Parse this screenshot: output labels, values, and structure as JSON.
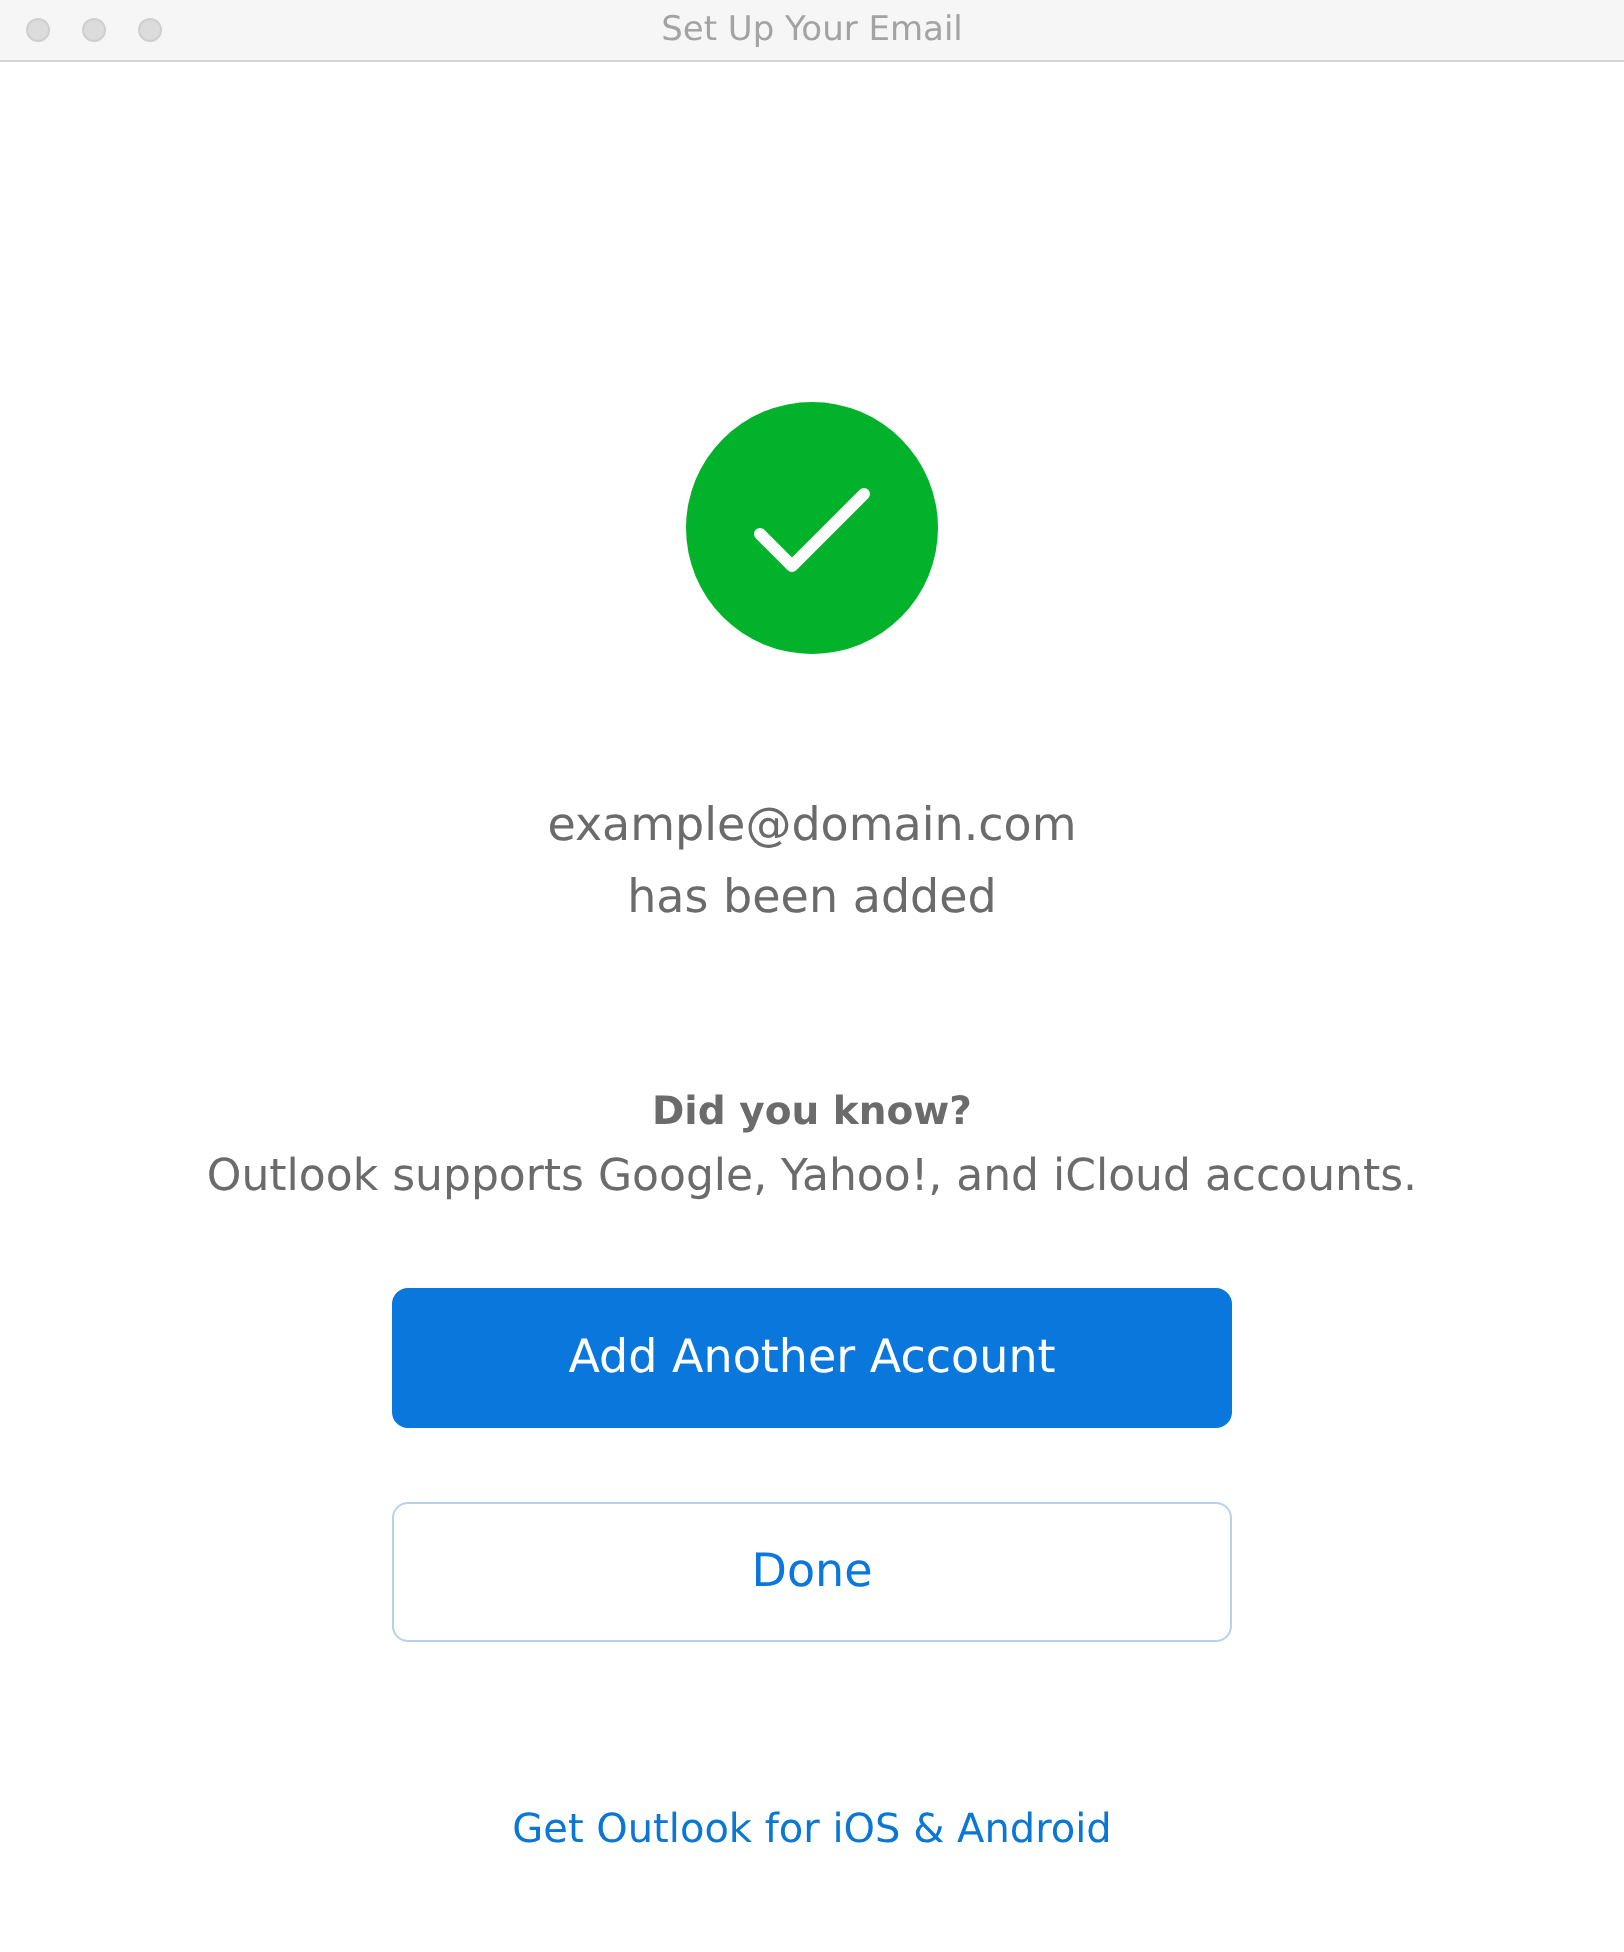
{
  "window": {
    "title": "Set Up Your Email",
    "active": false
  },
  "confirmation": {
    "email": "example@domain.com",
    "message": "has been added"
  },
  "tip": {
    "heading": "Did you know?",
    "text": "Outlook supports Google, Yahoo!, and iCloud accounts."
  },
  "buttons": [
    {
      "label": "Add Another Account",
      "kind": "primary"
    },
    {
      "label": "Done",
      "kind": "secondary"
    }
  ],
  "link": "Get Outlook for iOS & Android"
}
